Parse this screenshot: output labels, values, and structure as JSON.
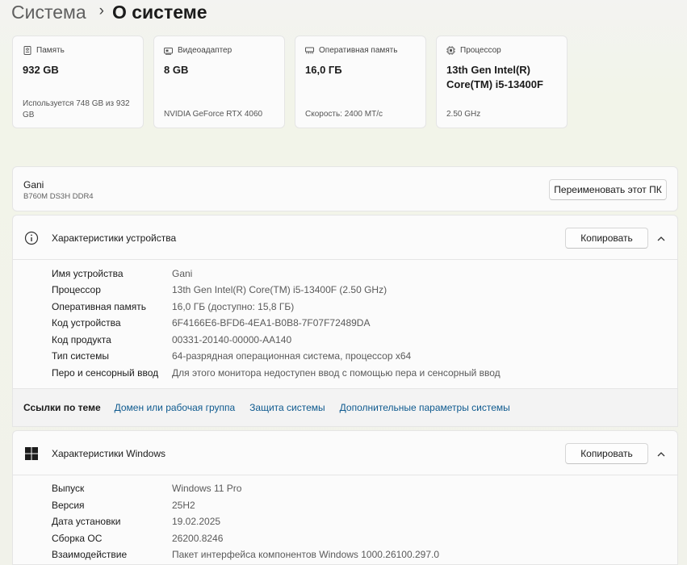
{
  "breadcrumb": {
    "parent": "Система",
    "separator": "›",
    "current": "О системе"
  },
  "spec_cards": [
    {
      "icon": "storage-icon",
      "label": "Память",
      "value": "932 GB",
      "sub": "Используется 748 GB из 932 GB"
    },
    {
      "icon": "gpu-icon",
      "label": "Видеоадаптер",
      "value": "8 GB",
      "sub": "NVIDIA GeForce RTX 4060"
    },
    {
      "icon": "ram-icon",
      "label": "Оперативная память",
      "value": "16,0 ГБ",
      "sub": "Скорость: 2400 MT/c"
    },
    {
      "icon": "cpu-icon",
      "label": "Процессор",
      "value": "13th Gen Intel(R) Core(TM) i5-13400F",
      "sub": "2.50 GHz"
    }
  ],
  "device": {
    "name": "Gani",
    "model": "B760M DS3H DDR4",
    "rename_label": "Переименовать этот ПК"
  },
  "device_specs": {
    "title": "Характеристики устройства",
    "copy_label": "Копировать",
    "rows": [
      {
        "key": "Имя устройства",
        "value": "Gani"
      },
      {
        "key": "Процессор",
        "value": "13th Gen Intel(R) Core(TM) i5-13400F (2.50 GHz)"
      },
      {
        "key": "Оперативная память",
        "value": "16,0 ГБ (доступно: 15,8 ГБ)"
      },
      {
        "key": "Код устройства",
        "value": "6F4166E6-BFD6-4EA1-B0B8-7F07F72489DA"
      },
      {
        "key": "Код продукта",
        "value": "00331-20140-00000-AA140"
      },
      {
        "key": "Тип системы",
        "value": "64-разрядная операционная система, процессор x64"
      },
      {
        "key": "Перо и сенсорный ввод",
        "value": "Для этого монитора недоступен ввод с помощью пера и сенсорный ввод"
      }
    ]
  },
  "related_links": {
    "label": "Ссылки по теме",
    "links": [
      "Домен или рабочая группа",
      "Защита системы",
      "Дополнительные параметры системы"
    ]
  },
  "windows_specs": {
    "title": "Характеристики Windows",
    "copy_label": "Копировать",
    "rows": [
      {
        "key": "Выпуск",
        "value": "Windows 11 Pro"
      },
      {
        "key": "Версия",
        "value": "25H2"
      },
      {
        "key": "Дата установки",
        "value": "19.02.2025"
      },
      {
        "key": "Сборка ОС",
        "value": "26200.8246"
      },
      {
        "key": "Взаимодействие",
        "value": "Пакет интерфейса компонентов Windows 1000.26100.297.0"
      }
    ]
  }
}
